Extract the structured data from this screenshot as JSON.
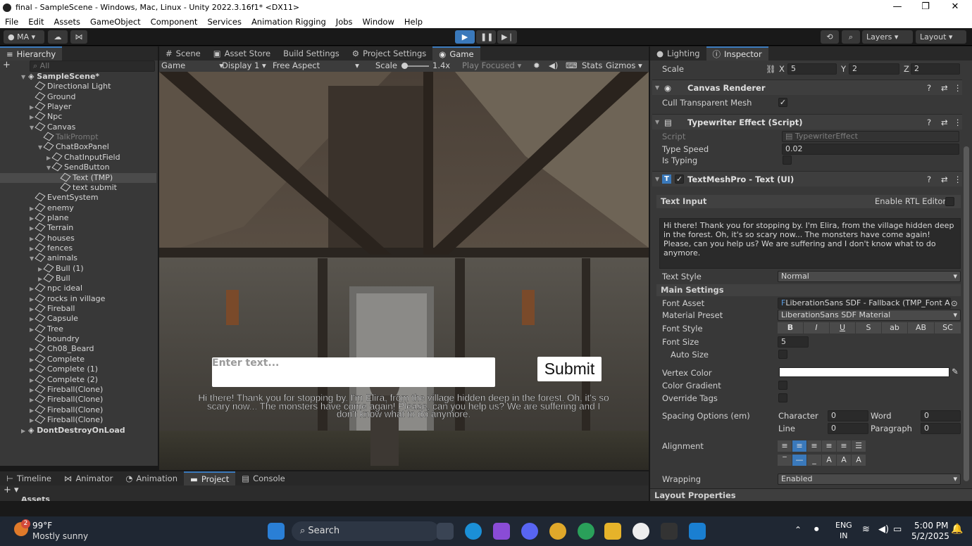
{
  "window": {
    "title": "final - SampleScene - Windows, Mac, Linux - Unity 2022.3.16f1* <DX11>"
  },
  "menu": [
    "File",
    "Edit",
    "Assets",
    "GameObject",
    "Component",
    "Services",
    "Animation Rigging",
    "Jobs",
    "Window",
    "Help"
  ],
  "toolbar": {
    "account": "MA",
    "layers": "Layers",
    "layout": "Layout"
  },
  "hierarchy": {
    "tab": "Hierarchy",
    "search_placeholder": "All",
    "scene": "SampleScene*",
    "items": [
      {
        "label": "Directional Light",
        "indent": 1,
        "arrow": ""
      },
      {
        "label": "Ground",
        "indent": 1,
        "arrow": ""
      },
      {
        "label": "Player",
        "indent": 1,
        "arrow": "▶"
      },
      {
        "label": "Npc",
        "indent": 1,
        "arrow": "▶"
      },
      {
        "label": "Canvas",
        "indent": 1,
        "arrow": "▼"
      },
      {
        "label": "TalkPrompt",
        "indent": 2,
        "arrow": "",
        "dim": true
      },
      {
        "label": "ChatBoxPanel",
        "indent": 2,
        "arrow": "▼"
      },
      {
        "label": "ChatInputField",
        "indent": 3,
        "arrow": "▶"
      },
      {
        "label": "SendButton",
        "indent": 3,
        "arrow": "▼"
      },
      {
        "label": "Text (TMP)",
        "indent": 4,
        "arrow": "",
        "sel": true
      },
      {
        "label": "text submit",
        "indent": 4,
        "arrow": ""
      },
      {
        "label": "EventSystem",
        "indent": 1,
        "arrow": ""
      },
      {
        "label": "enemy",
        "indent": 1,
        "arrow": "▶"
      },
      {
        "label": "plane",
        "indent": 1,
        "arrow": "▶"
      },
      {
        "label": "Terrain",
        "indent": 1,
        "arrow": "▶"
      },
      {
        "label": "houses",
        "indent": 1,
        "arrow": "▶"
      },
      {
        "label": "fences",
        "indent": 1,
        "arrow": "▶"
      },
      {
        "label": "animals",
        "indent": 1,
        "arrow": "▼"
      },
      {
        "label": "Bull (1)",
        "indent": 2,
        "arrow": "▶"
      },
      {
        "label": "Bull",
        "indent": 2,
        "arrow": "▶"
      },
      {
        "label": "npc ideal",
        "indent": 1,
        "arrow": "▶"
      },
      {
        "label": "rocks in village",
        "indent": 1,
        "arrow": "▶"
      },
      {
        "label": "Fireball",
        "indent": 1,
        "arrow": "▶"
      },
      {
        "label": "Capsule",
        "indent": 1,
        "arrow": "▶"
      },
      {
        "label": "Tree",
        "indent": 1,
        "arrow": "▶"
      },
      {
        "label": "boundry",
        "indent": 1,
        "arrow": ""
      },
      {
        "label": "Ch08_Beard",
        "indent": 1,
        "arrow": "▶"
      },
      {
        "label": "Complete",
        "indent": 1,
        "arrow": "▶"
      },
      {
        "label": "Complete (1)",
        "indent": 1,
        "arrow": "▶"
      },
      {
        "label": "Complete (2)",
        "indent": 1,
        "arrow": "▶"
      },
      {
        "label": "Fireball(Clone)",
        "indent": 1,
        "arrow": "▶"
      },
      {
        "label": "Fireball(Clone)",
        "indent": 1,
        "arrow": "▶"
      },
      {
        "label": "Fireball(Clone)",
        "indent": 1,
        "arrow": "▶"
      },
      {
        "label": "Fireball(Clone)",
        "indent": 1,
        "arrow": "▶"
      }
    ],
    "dontdestroy": "DontDestroyOnLoad"
  },
  "center_tabs": {
    "scene": "Scene",
    "asset_store": "Asset Store",
    "build_settings": "Build Settings",
    "project_settings": "Project Settings",
    "game": "Game"
  },
  "game_toolbar": {
    "view": "Game",
    "display": "Display 1",
    "aspect": "Free Aspect",
    "scale_label": "Scale",
    "scale_value": "1.4x",
    "play_focused": "Play Focused",
    "stats": "Stats",
    "gizmos": "Gizmos"
  },
  "game_view": {
    "input_placeholder": "Enter text...",
    "submit": "Submit",
    "dialogue": "Hi there! Thank you for stopping by. I'm Elira, from the village hidden deep in the forest. Oh, it's so scary now... The monsters have come again! Please, can you help us? We are suffering and I don't know what to do anymore."
  },
  "inspector": {
    "tab_lighting": "Lighting",
    "tab_inspector": "Inspector",
    "scale": {
      "label": "Scale",
      "x_label": "X",
      "x": "5",
      "y_label": "Y",
      "y": "2",
      "z_label": "Z",
      "z": "2"
    },
    "canvas_renderer": {
      "title": "Canvas Renderer",
      "cull_label": "Cull Transparent Mesh",
      "cull": "✓"
    },
    "typewriter": {
      "title": "Typewriter Effect (Script)",
      "script_label": "Script",
      "script_value": "TypewriterEffect",
      "type_speed_label": "Type Speed",
      "type_speed": "0.02",
      "is_typing_label": "Is Typing"
    },
    "tmp": {
      "title": "TextMeshPro - Text (UI)",
      "check": "✓",
      "text_input_label": "Text Input",
      "rtl_label": "Enable RTL Editor",
      "text_value": "Hi there! Thank you for stopping by. I'm Elira, from the village hidden deep in the forest. Oh, it's so scary now... The monsters have come again! Please, can you help us? We are suffering and I don't know what to do anymore.",
      "text_style_label": "Text Style",
      "text_style": "Normal",
      "main_settings": "Main Settings",
      "font_asset_label": "Font Asset",
      "font_asset": "LiberationSans SDF - Fallback (TMP_Font A",
      "material_label": "Material Preset",
      "material": "LiberationSans SDF Material",
      "font_style_label": "Font Style",
      "styles": [
        "B",
        "I",
        "U",
        "S",
        "ab",
        "AB",
        "SC"
      ],
      "font_size_label": "Font Size",
      "font_size": "5",
      "auto_size_label": "Auto Size",
      "vertex_color_label": "Vertex Color",
      "gradient_label": "Color Gradient",
      "override_tags_label": "Override Tags",
      "spacing_label": "Spacing Options (em)",
      "character_label": "Character",
      "character": "0",
      "word_label": "Word",
      "word": "0",
      "line_label": "Line",
      "line": "0",
      "paragraph_label": "Paragraph",
      "paragraph": "0",
      "alignment_label": "Alignment",
      "wrapping_label": "Wrapping",
      "wrapping": "Enabled"
    },
    "layout_properties": "Layout Properties"
  },
  "bottom_tabs": {
    "timeline": "Timeline",
    "animator": "Animator",
    "animation": "Animation",
    "project": "Project",
    "console": "Console",
    "assets": "Assets"
  },
  "taskbar": {
    "temp": "99°F",
    "weather": "Mostly sunny",
    "badge": "2",
    "search": "Search",
    "lang1": "ENG",
    "lang2": "IN",
    "time": "5:00 PM",
    "date": "5/2/2025"
  },
  "colors": {
    "accent": "#3a79bb",
    "panel": "#383838",
    "titlebar": "#ffffff",
    "taskbar": "#1f2733"
  }
}
